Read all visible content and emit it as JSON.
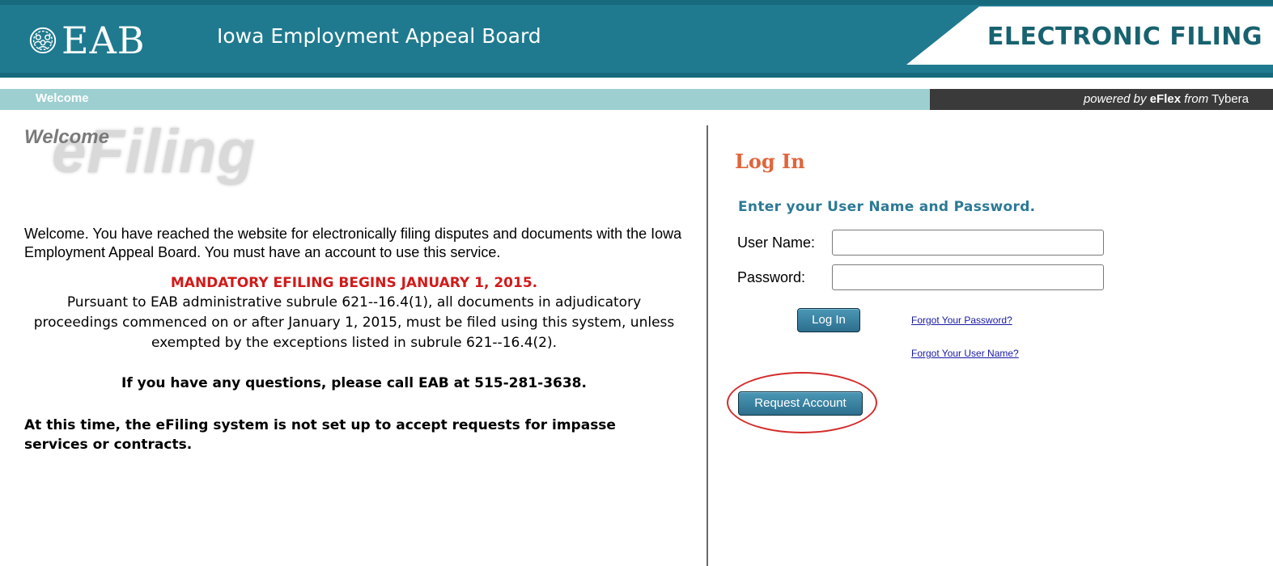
{
  "header": {
    "logo_text": "EAB",
    "org_name": "Iowa Employment Appeal Board",
    "banner": "ELECTRONIC FILING"
  },
  "subbar": {
    "welcome_tab": "Welcome",
    "powered_prefix": "powered by",
    "powered_product": "eFlex",
    "powered_from": "from",
    "powered_vendor": "Tybera"
  },
  "left": {
    "welcome_title": "Welcome",
    "ghost_title": "eFiling",
    "intro": "Welcome. You have reached the website for electronically filing disputes and documents with the Iowa Employment Appeal Board. You must have an account to use this service.",
    "mandatory": "MANDATORY EFILING BEGINS JANUARY 1, 2015.",
    "pursuant": "Pursuant to EAB administrative subrule 621--16.4(1), all documents in adjudicatory proceedings commenced on or after January 1, 2015, must be filed using this system, unless exempted by the exceptions listed in subrule 621--16.4(2).",
    "questions": "If you have any questions, please call EAB at 515-281-3638.",
    "notice": "At this time, the eFiling system is not set up to accept requests for impasse services or contracts."
  },
  "login": {
    "title": "Log In",
    "subtitle": "Enter your User Name and Password.",
    "username_label": "User Name:",
    "password_label": "Password:",
    "username_value": "",
    "password_value": "",
    "login_button": "Log In",
    "forgot_password": "Forgot Your Password?",
    "forgot_username": "Forgot Your User Name?",
    "request_account": "Request Account"
  },
  "colors": {
    "header_bg": "#1f7a8f",
    "subbar_bg": "#9dcfd0",
    "powered_bg": "#3a3a3a",
    "mandatory_red": "#d21a1a",
    "login_title": "#e0653c",
    "login_sub": "#2c7a96",
    "annotation_circle": "#d42b2b"
  },
  "icons": {
    "logo": "people-circle-icon"
  }
}
